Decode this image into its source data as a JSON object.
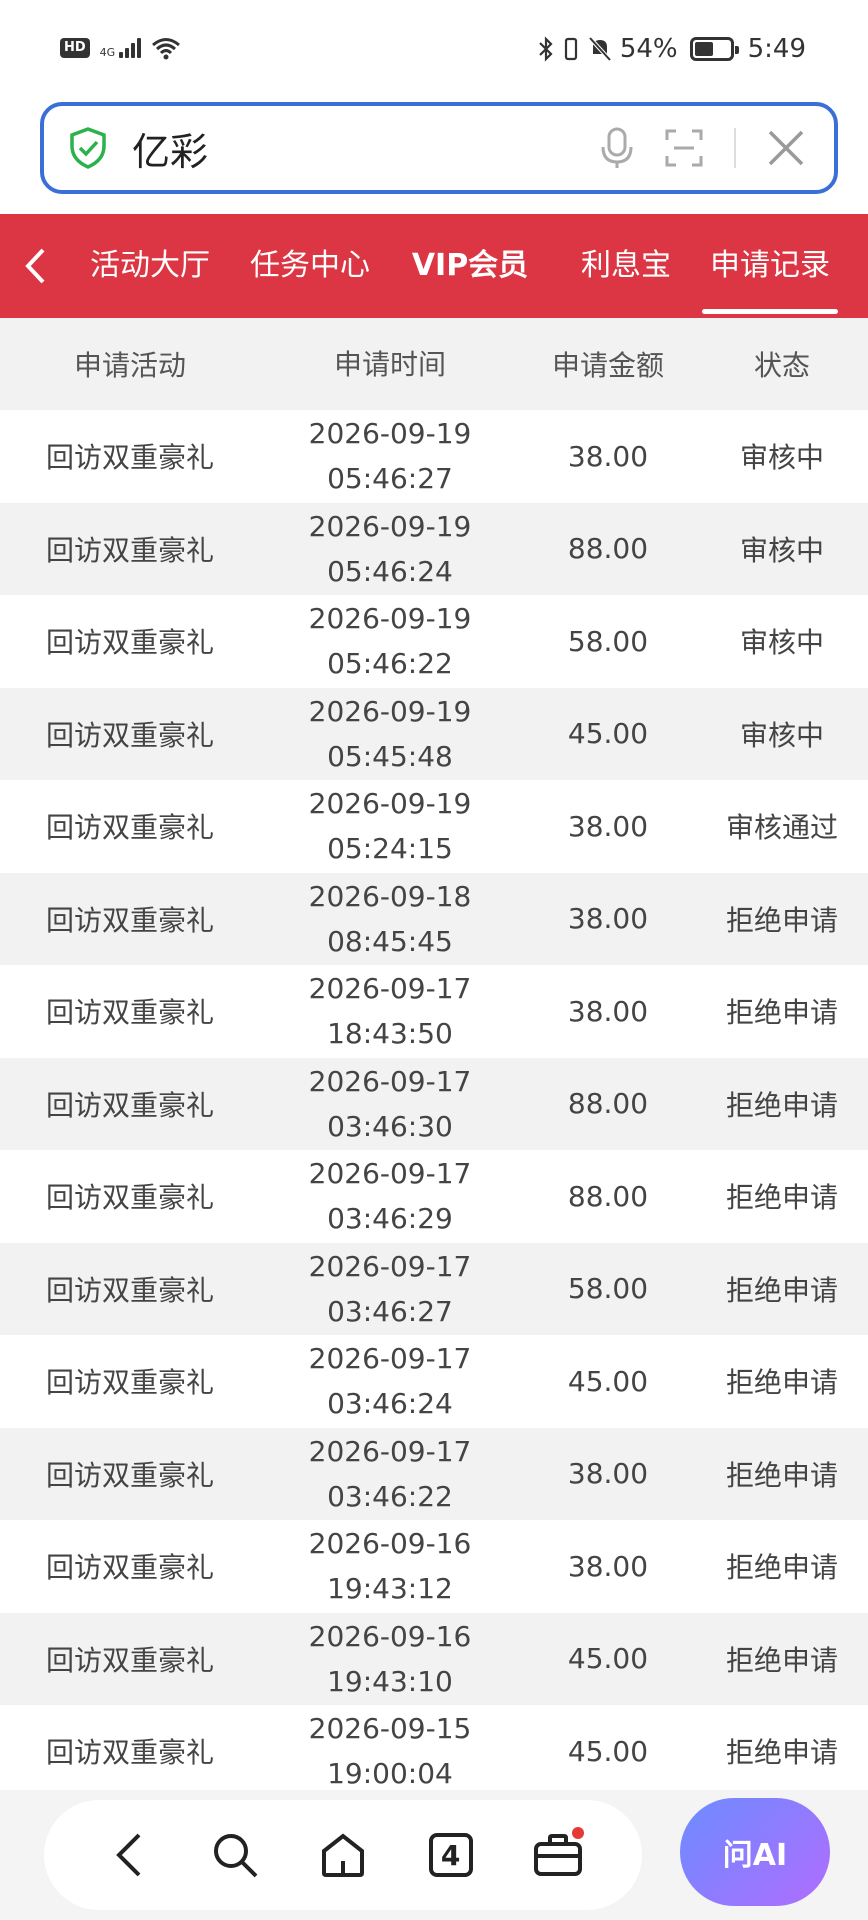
{
  "status_bar": {
    "hd": "HD",
    "signal": "4G",
    "battery_percent": "54%",
    "battery_level": 0.54,
    "time": "5:49"
  },
  "search": {
    "query": "亿彩"
  },
  "nav": {
    "items": [
      {
        "label": "活动大厅"
      },
      {
        "label": "任务中心"
      },
      {
        "label": "VIP会员"
      },
      {
        "label": "利息宝"
      },
      {
        "label": "申请记录"
      }
    ],
    "active": "申请记录"
  },
  "table": {
    "headers": [
      "申请活动",
      "申请时间",
      "申请金额",
      "状态"
    ],
    "rows": [
      {
        "activity": "回访双重豪礼",
        "date": "2026-09-19",
        "time": "05:46:27",
        "amount": "38.00",
        "status": "审核中"
      },
      {
        "activity": "回访双重豪礼",
        "date": "2026-09-19",
        "time": "05:46:24",
        "amount": "88.00",
        "status": "审核中"
      },
      {
        "activity": "回访双重豪礼",
        "date": "2026-09-19",
        "time": "05:46:22",
        "amount": "58.00",
        "status": "审核中"
      },
      {
        "activity": "回访双重豪礼",
        "date": "2026-09-19",
        "time": "05:45:48",
        "amount": "45.00",
        "status": "审核中"
      },
      {
        "activity": "回访双重豪礼",
        "date": "2026-09-19",
        "time": "05:24:15",
        "amount": "38.00",
        "status": "审核通过"
      },
      {
        "activity": "回访双重豪礼",
        "date": "2026-09-18",
        "time": "08:45:45",
        "amount": "38.00",
        "status": "拒绝申请"
      },
      {
        "activity": "回访双重豪礼",
        "date": "2026-09-17",
        "time": "18:43:50",
        "amount": "38.00",
        "status": "拒绝申请"
      },
      {
        "activity": "回访双重豪礼",
        "date": "2026-09-17",
        "time": "03:46:30",
        "amount": "88.00",
        "status": "拒绝申请"
      },
      {
        "activity": "回访双重豪礼",
        "date": "2026-09-17",
        "time": "03:46:29",
        "amount": "88.00",
        "status": "拒绝申请"
      },
      {
        "activity": "回访双重豪礼",
        "date": "2026-09-17",
        "time": "03:46:27",
        "amount": "58.00",
        "status": "拒绝申请"
      },
      {
        "activity": "回访双重豪礼",
        "date": "2026-09-17",
        "time": "03:46:24",
        "amount": "45.00",
        "status": "拒绝申请"
      },
      {
        "activity": "回访双重豪礼",
        "date": "2026-09-17",
        "time": "03:46:22",
        "amount": "38.00",
        "status": "拒绝申请"
      },
      {
        "activity": "回访双重豪礼",
        "date": "2026-09-16",
        "time": "19:43:12",
        "amount": "38.00",
        "status": "拒绝申请"
      },
      {
        "activity": "回访双重豪礼",
        "date": "2026-09-16",
        "time": "19:43:10",
        "amount": "45.00",
        "status": "拒绝申请"
      },
      {
        "activity": "回访双重豪礼",
        "date": "2026-09-15",
        "time": "19:00:04",
        "amount": "45.00",
        "status": "拒绝申请"
      }
    ]
  },
  "bottom_bar": {
    "tab_count": "4",
    "ai_label": "问AI"
  },
  "colors": {
    "nav_red": "#dc3543",
    "search_border": "#3a6fd8",
    "shield_green": "#2bb24c"
  }
}
